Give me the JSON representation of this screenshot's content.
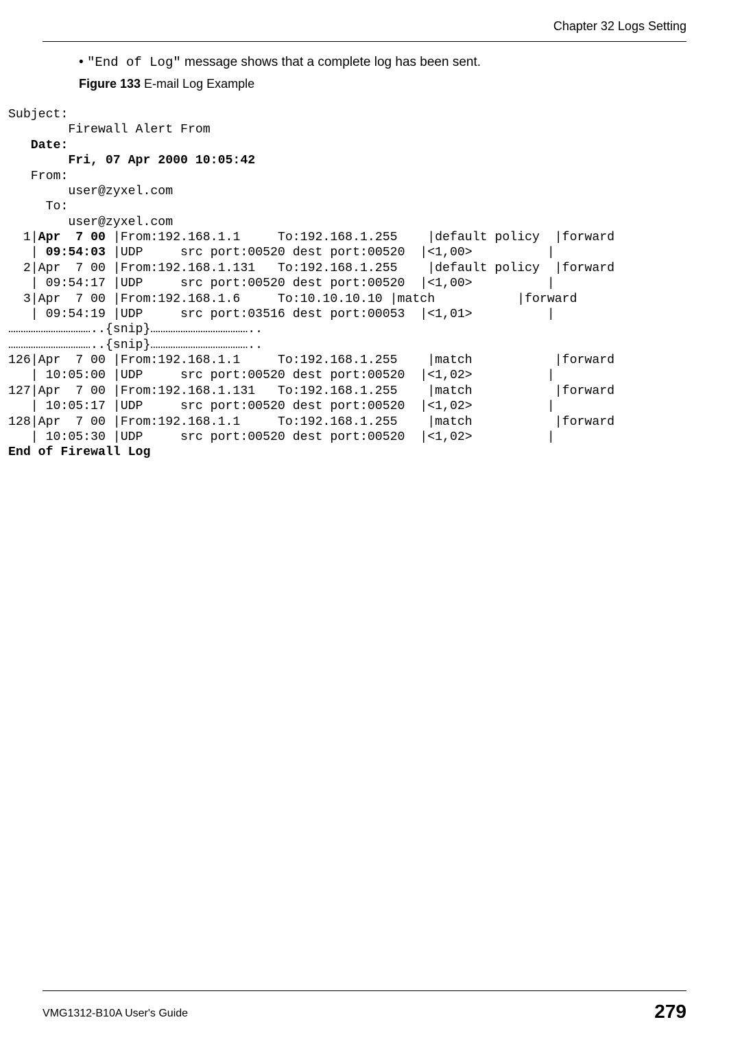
{
  "header": {
    "chapter": "Chapter 32 Logs Setting"
  },
  "bullet": {
    "prefix": "• ",
    "code": "\"End of Log\"",
    "rest": " message shows that a complete log has been sent."
  },
  "figure": {
    "label": "Figure 133",
    "caption": "   E-mail Log Example"
  },
  "log": {
    "subject_label": "Subject: ",
    "subject_value": "        Firewall Alert From ",
    "date_label": "   Date: ",
    "date_value": "        Fri, 07 Apr 2000 10:05:42",
    "from_label": "   From: ",
    "from_value": "        user@zyxel.com",
    "to_label": "     To: ",
    "to_value": "        user@zyxel.com",
    "row1a": "  1|Apr  7 00 |From:192.168.1.1     To:192.168.1.255    |default policy  |forward",
    "row1b": "   | 09:54:03 |UDP     src port:00520 dest port:00520  |<1,00>          |         ",
    "row2a": "  2|Apr  7 00 |From:192.168.1.131   To:192.168.1.255    |default policy  |forward",
    "row2b": "   | 09:54:17 |UDP     src port:00520 dest port:00520  |<1,00>          |         ",
    "row3a": "  3|Apr  7 00 |From:192.168.1.6     To:10.10.10.10 |match           |forward",
    "row3b": "   | 09:54:19 |UDP     src port:03516 dest port:00053  |<1,01>          |         ",
    "snip1": "……………………………..{snip}…………………………………..",
    "snip2": "……………………………..{snip}…………………………………..",
    "row126a": "126|Apr  7 00 |From:192.168.1.1     To:192.168.1.255    |match           |forward",
    "row126b": "   | 10:05:00 |UDP     src port:00520 dest port:00520  |<1,02>          |         ",
    "row127a": "127|Apr  7 00 |From:192.168.1.131   To:192.168.1.255    |match           |forward",
    "row127b": "   | 10:05:17 |UDP     src port:00520 dest port:00520  |<1,02>          |         ",
    "row128a": "128|Apr  7 00 |From:192.168.1.1     To:192.168.1.255    |match           |forward",
    "row128b": "   | 10:05:30 |UDP     src port:00520 dest port:00520  |<1,02>          |         ",
    "end": "End of Firewall Log"
  },
  "footer": {
    "left": "VMG1312-B10A User's Guide",
    "right": "279"
  }
}
